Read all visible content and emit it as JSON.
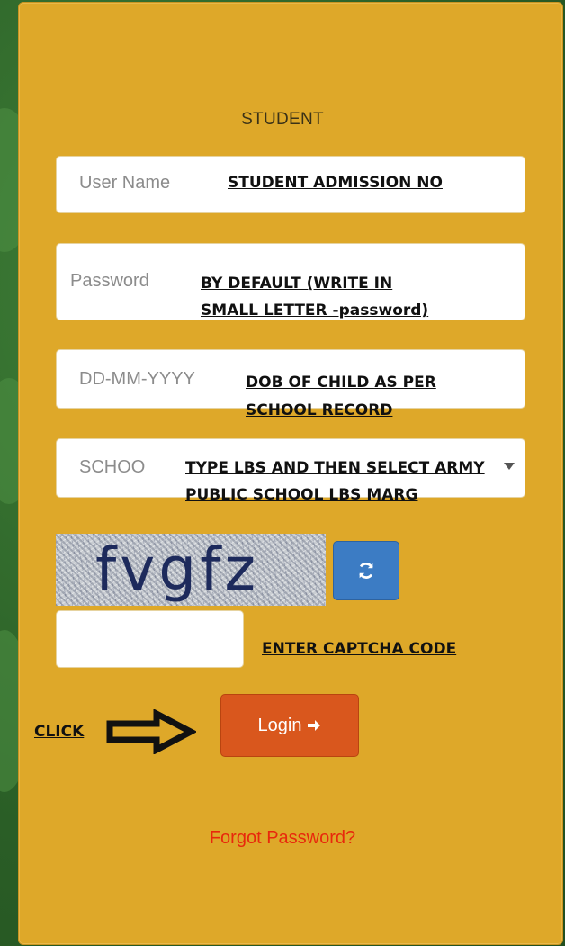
{
  "form": {
    "title": "STUDENT",
    "username": {
      "placeholder": "User Name"
    },
    "password": {
      "placeholder": "Password"
    },
    "dob": {
      "placeholder": "DD-MM-YYYY"
    },
    "school": {
      "placeholder": "SCHOO"
    },
    "captcha": {
      "text": "fvgfz"
    },
    "login_label": "Login",
    "forgot_label": "Forgot Password?"
  },
  "annotations": {
    "username_note": "STUDENT ADMISSION NO",
    "password_note_line1": "BY DEFAULT (WRITE IN",
    "password_note_line2": "SMALL LETTER -password)",
    "dob_note_line1": "DOB OF CHILD AS PER",
    "dob_note_line2": "SCHOOL RECORD",
    "school_note_line1": "TYPE LBS AND THEN SELECT ARMY",
    "school_note_line2": "PUBLIC SCHOOL LBS MARG",
    "captcha_note": "ENTER CAPTCHA CODE",
    "click_note": "CLICK"
  },
  "icons": {
    "refresh": "refresh-icon",
    "login_arrow": "arrow-right-icon",
    "pointer_arrow": "hollow-arrow-right-icon"
  },
  "colors": {
    "panel": "#dea829",
    "login_button": "#d9571d",
    "refresh_button": "#3c7cc4",
    "forgot_link": "#e8280c"
  }
}
